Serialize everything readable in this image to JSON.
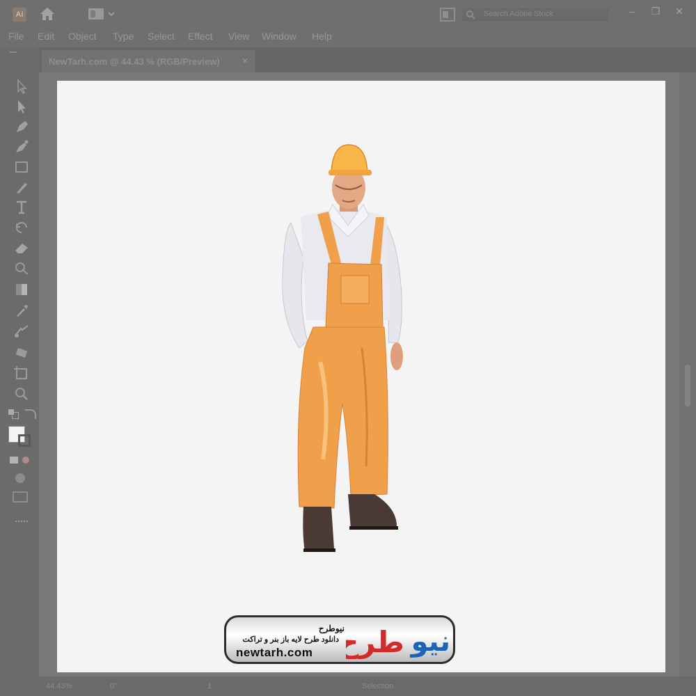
{
  "app": {
    "logo_text": "Ai"
  },
  "search": {
    "placeholder": "Search Adobe Stock"
  },
  "menu": [
    "File",
    "Edit",
    "Object",
    "Type",
    "Select",
    "Effect",
    "View",
    "Window",
    "Help"
  ],
  "document": {
    "tab_title": "NewTarh.com @ 44.43 % (RGB/Preview)",
    "close_label": "×"
  },
  "window_buttons": {
    "minimize": "–",
    "restore": "❐",
    "close": "✕"
  },
  "status": {
    "zoom": "44.43%",
    "rotation": "0°",
    "page": "1",
    "tool": "Selection"
  },
  "watermark": {
    "name_fa": "نیوطرح",
    "tagline_fa": "دانلود طرح لایه باز بنر و تراکت",
    "url": "newtarh.com",
    "logo_word": "نیوطرح",
    "logo_colors": {
      "blue": "#1e63b5",
      "red": "#d32a2a"
    }
  },
  "icons": [
    "app-logo-icon",
    "home-icon",
    "workspace-icon",
    "arrange-icon",
    "search-icon",
    "selection-tool-icon",
    "direct-selection-tool-icon",
    "pen-tool-icon",
    "curvature-tool-icon",
    "rectangle-tool-icon",
    "paintbrush-tool-icon",
    "type-tool-icon",
    "rotate-tool-icon",
    "eraser-tool-icon",
    "shape-builder-tool-icon",
    "gradient-tool-icon",
    "eyedropper-tool-icon",
    "blend-tool-icon",
    "symbol-sprayer-tool-icon",
    "artboard-tool-icon",
    "zoom-tool-icon"
  ],
  "colors": {
    "chrome": "#6f6f6f",
    "artboard": "#f4f4f5",
    "overalls": "#f0a04b",
    "helmet": "#f7b54a",
    "shirt": "#e8e8ee"
  }
}
